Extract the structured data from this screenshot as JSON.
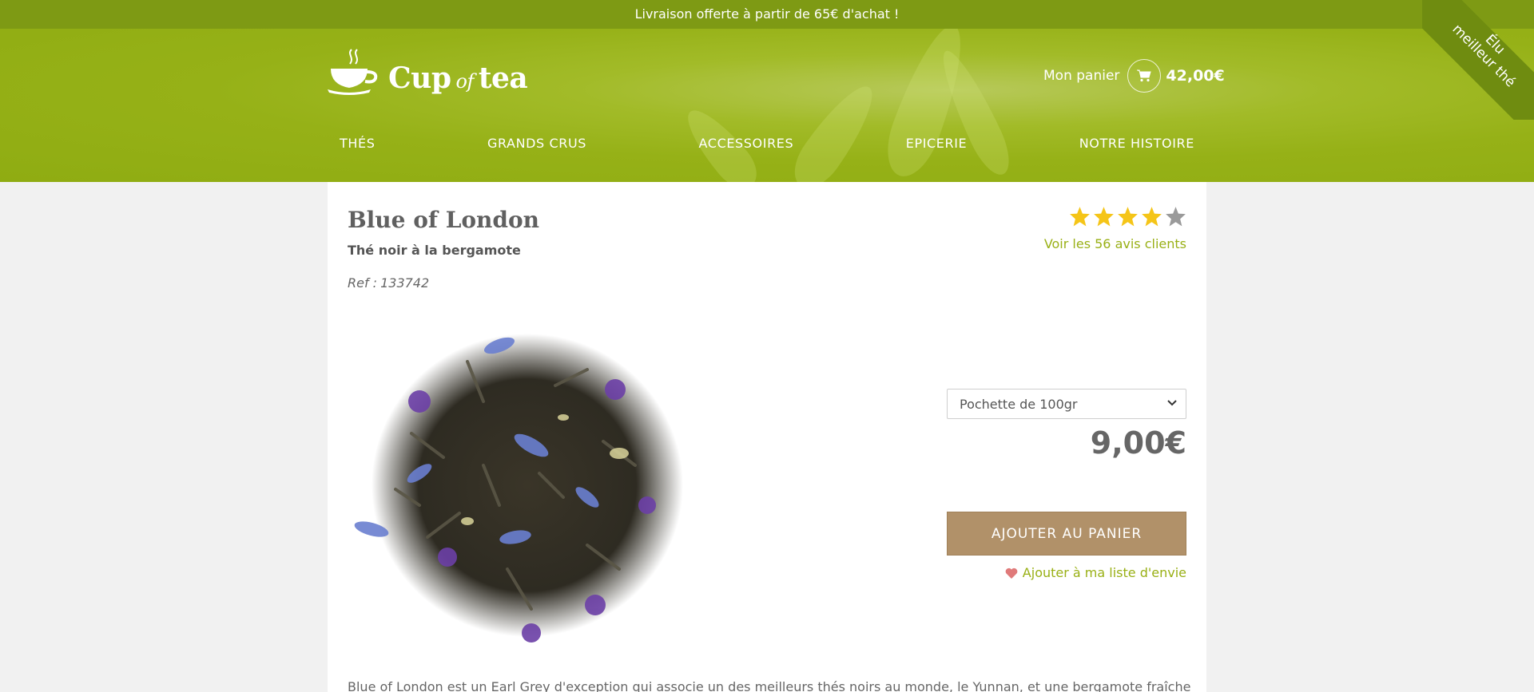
{
  "promo": {
    "text": "Livraison offerte à partir de 65€ d'achat !"
  },
  "brand": {
    "cup": "Cup",
    "of": "of",
    "tea": "tea"
  },
  "cart": {
    "label": "Mon panier",
    "total": "42,00€",
    "icon": "cart-icon"
  },
  "nav": {
    "items": [
      "THÉS",
      "GRANDS CRUS",
      "ACCESSOIRES",
      "EPICERIE",
      "NOTRE HISTOIRE"
    ]
  },
  "ribbon": {
    "line1": "Élu",
    "line2": "meilleur thé"
  },
  "product": {
    "title": "Blue of London",
    "subtitle": "Thé noir à la bergamote",
    "ref_label": "Ref :",
    "ref_value": "133742",
    "rating": 4,
    "rating_max": 5,
    "reviews_link": "Voir les 56 avis clients",
    "variant_selected": "Pochette de 100gr",
    "price": "9,00€",
    "add_to_cart": "AJOUTER AU PANIER",
    "wishlist": "Ajouter à ma liste d'envie",
    "description": "Blue of London est un Earl Grey d'exception qui associe un des meilleurs thés noirs au monde, le Yunnan, et une bergamote fraîche et"
  },
  "colors": {
    "header_green": "#96b117",
    "promo_green": "#7e9a14",
    "accent_green": "#99b015",
    "button_brown": "#b19169",
    "star_gold": "#f5c518",
    "star_grey": "#9a9a9a"
  }
}
